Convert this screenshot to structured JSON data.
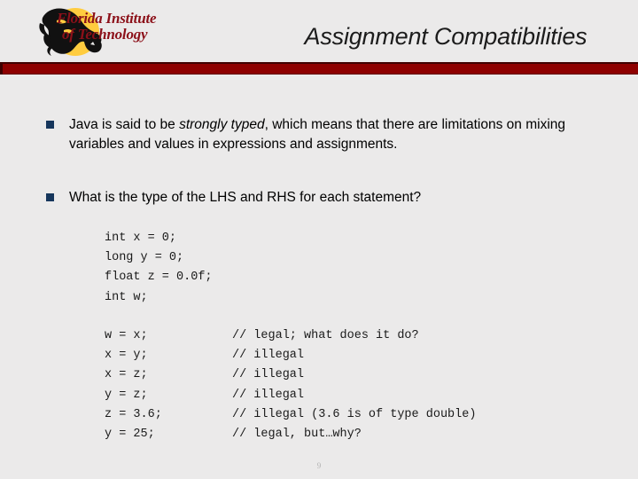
{
  "header": {
    "title": "Assignment Compatibilities",
    "logo": {
      "line1": "Florida Institute",
      "line2": "of Technology",
      "disc_color": "#ffcc3f",
      "wordmark_color": "#8c1019",
      "mascot": "panther-head"
    },
    "rule_color": "#8e0000"
  },
  "body": {
    "bullets": [
      {
        "marker_color": "#16365c",
        "parts": [
          {
            "text": "Java is said to be ",
            "style": "normal"
          },
          {
            "text": "strongly typed",
            "style": "italic"
          },
          {
            "text": ", which means that there are limitations on mixing variables and values in expressions and assignments.",
            "style": "normal"
          }
        ]
      },
      {
        "marker_color": "#16365c",
        "parts": [
          {
            "text": "What is the type of the LHS and RHS for each statement?",
            "style": "normal"
          }
        ]
      }
    ],
    "code_declarations": [
      {
        "statement": "int x = 0;",
        "comment": ""
      },
      {
        "statement": "long y = 0;",
        "comment": ""
      },
      {
        "statement": "float z = 0.0f;",
        "comment": ""
      },
      {
        "statement": "int w;",
        "comment": ""
      }
    ],
    "code_assignments": [
      {
        "statement": "w = x;",
        "comment": "// legal; what does it do?"
      },
      {
        "statement": "x = y;",
        "comment": "// illegal"
      },
      {
        "statement": "x = z;",
        "comment": "// illegal"
      },
      {
        "statement": "y = z;",
        "comment": "// illegal"
      },
      {
        "statement": "z = 3.6;",
        "comment": "// illegal (3.6 is of type double)"
      },
      {
        "statement": "y = 25;",
        "comment": "// legal, but…why?"
      }
    ]
  },
  "footer": {
    "page_number": "9"
  }
}
